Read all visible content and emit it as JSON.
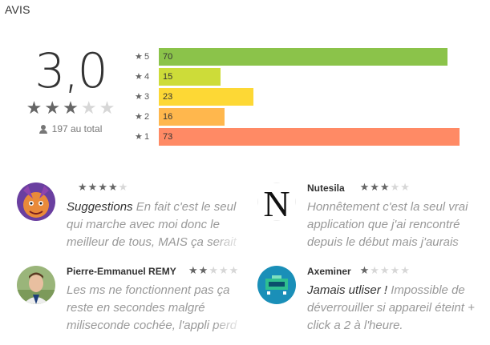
{
  "title": "AVIS",
  "summary": {
    "score": "3,0",
    "stars_filled": 3,
    "stars_total": 5,
    "total_label": "197 au total",
    "icon": "person-icon"
  },
  "histogram": [
    {
      "star": "5",
      "count": "70",
      "value": 70,
      "color": "#8bc34a"
    },
    {
      "star": "4",
      "count": "15",
      "value": 15,
      "color": "#cddc39"
    },
    {
      "star": "3",
      "count": "23",
      "value": 23,
      "color": "#fdd835"
    },
    {
      "star": "2",
      "count": "16",
      "value": 16,
      "color": "#ffb74d"
    },
    {
      "star": "1",
      "count": "73",
      "value": 73,
      "color": "#ff8a65"
    }
  ],
  "reviews": [
    {
      "author": "",
      "rating": 4,
      "review_title": "Suggestions",
      "body": "En fait c'est le seul qui marche avec moi donc le meilleur de tous, MAIS ça serait",
      "avatar": "dragon-avatar"
    },
    {
      "author": "Nutesila",
      "rating": 3,
      "review_title": "",
      "body": "Honnêtement c'est la seul vrai application que j'ai rencontré depuis le début mais j'aurais",
      "avatar": "letter-n-avatar"
    },
    {
      "author": "Pierre-Emmanuel REMY",
      "rating": 2,
      "review_title": "",
      "body": "Les ms ne fonctionnent pas ça reste en secondes malgré miliseconde cochée, l'appli perd",
      "avatar": "portrait-avatar"
    },
    {
      "author": "Axeminer",
      "rating": 1,
      "review_title": "Jamais utliser !",
      "body": "Impossible de déverrouiller si appareil éteint + click a 2 à l'heure.",
      "avatar": "pixel-art-avatar"
    }
  ],
  "colors": {
    "star_filled": "#666666",
    "star_empty": "#d7d7d7"
  }
}
